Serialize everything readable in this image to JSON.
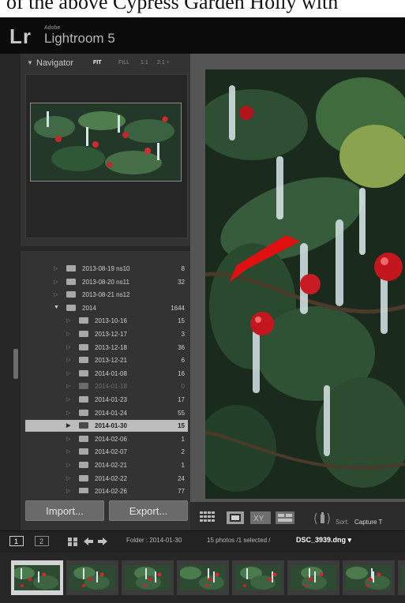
{
  "caption_fragment": "of the above Cypress Garden Holly with",
  "app": {
    "logo": "Lr",
    "vendor": "Adobe",
    "name": "Lightroom 5"
  },
  "navigator": {
    "title": "Navigator",
    "zoom_options": [
      "FIT",
      "FILL",
      "1:1",
      "2:1 ÷"
    ],
    "active_zoom": "FIT"
  },
  "folders": [
    {
      "name": "2013-08-19 ns10",
      "count": "8",
      "level": 1,
      "state": "normal"
    },
    {
      "name": "2013-08-20 ns11",
      "count": "32",
      "level": 1,
      "state": "normal"
    },
    {
      "name": "2013-08-21 ns12",
      "count": "",
      "level": 1,
      "state": "normal"
    },
    {
      "name": "2014",
      "count": "1644",
      "level": 1,
      "state": "expanded"
    },
    {
      "name": "2013-10-16",
      "count": "15",
      "level": 2,
      "state": "normal"
    },
    {
      "name": "2013-12-17",
      "count": "3",
      "level": 2,
      "state": "normal"
    },
    {
      "name": "2013-12-18",
      "count": "36",
      "level": 2,
      "state": "normal"
    },
    {
      "name": "2013-12-21",
      "count": "6",
      "level": 2,
      "state": "normal"
    },
    {
      "name": "2014-01-08",
      "count": "16",
      "level": 2,
      "state": "normal"
    },
    {
      "name": "2014-01-18",
      "count": "0",
      "level": 2,
      "state": "dim"
    },
    {
      "name": "2014-01-23",
      "count": "17",
      "level": 2,
      "state": "normal"
    },
    {
      "name": "2014-01-24",
      "count": "55",
      "level": 2,
      "state": "normal"
    },
    {
      "name": "2014-01-30",
      "count": "15",
      "level": 2,
      "state": "selected"
    },
    {
      "name": "2014-02-06",
      "count": "1",
      "level": 2,
      "state": "normal"
    },
    {
      "name": "2014-02-07",
      "count": "2",
      "level": 2,
      "state": "normal"
    },
    {
      "name": "2014-02-21",
      "count": "1",
      "level": 2,
      "state": "normal"
    },
    {
      "name": "2014-02-22",
      "count": "24",
      "level": 2,
      "state": "normal"
    },
    {
      "name": "2014-02-26",
      "count": "77",
      "level": 2,
      "state": "normal"
    }
  ],
  "buttons": {
    "import": "Import...",
    "export": "Export..."
  },
  "toolbar": {
    "sort_label": "Sort:",
    "sort_value": "Capture T"
  },
  "filmstrip_header": {
    "monitor_1": "1",
    "monitor_2": "2",
    "folder": "Folder : 2014-01-30",
    "selection": "15 photos /1 selected /",
    "filename": "DSC_3939.dng ▾"
  },
  "colors": {
    "annotation_arrow": "#e01010",
    "selected_row": "#bdbdbd",
    "panel": "#333333"
  },
  "icons": [
    "grid-view-icon",
    "loupe-view-icon",
    "compare-view-icon",
    "survey-view-icon",
    "spray-can-icon",
    "arrow-left-icon",
    "arrow-right-icon",
    "folder-icon"
  ]
}
